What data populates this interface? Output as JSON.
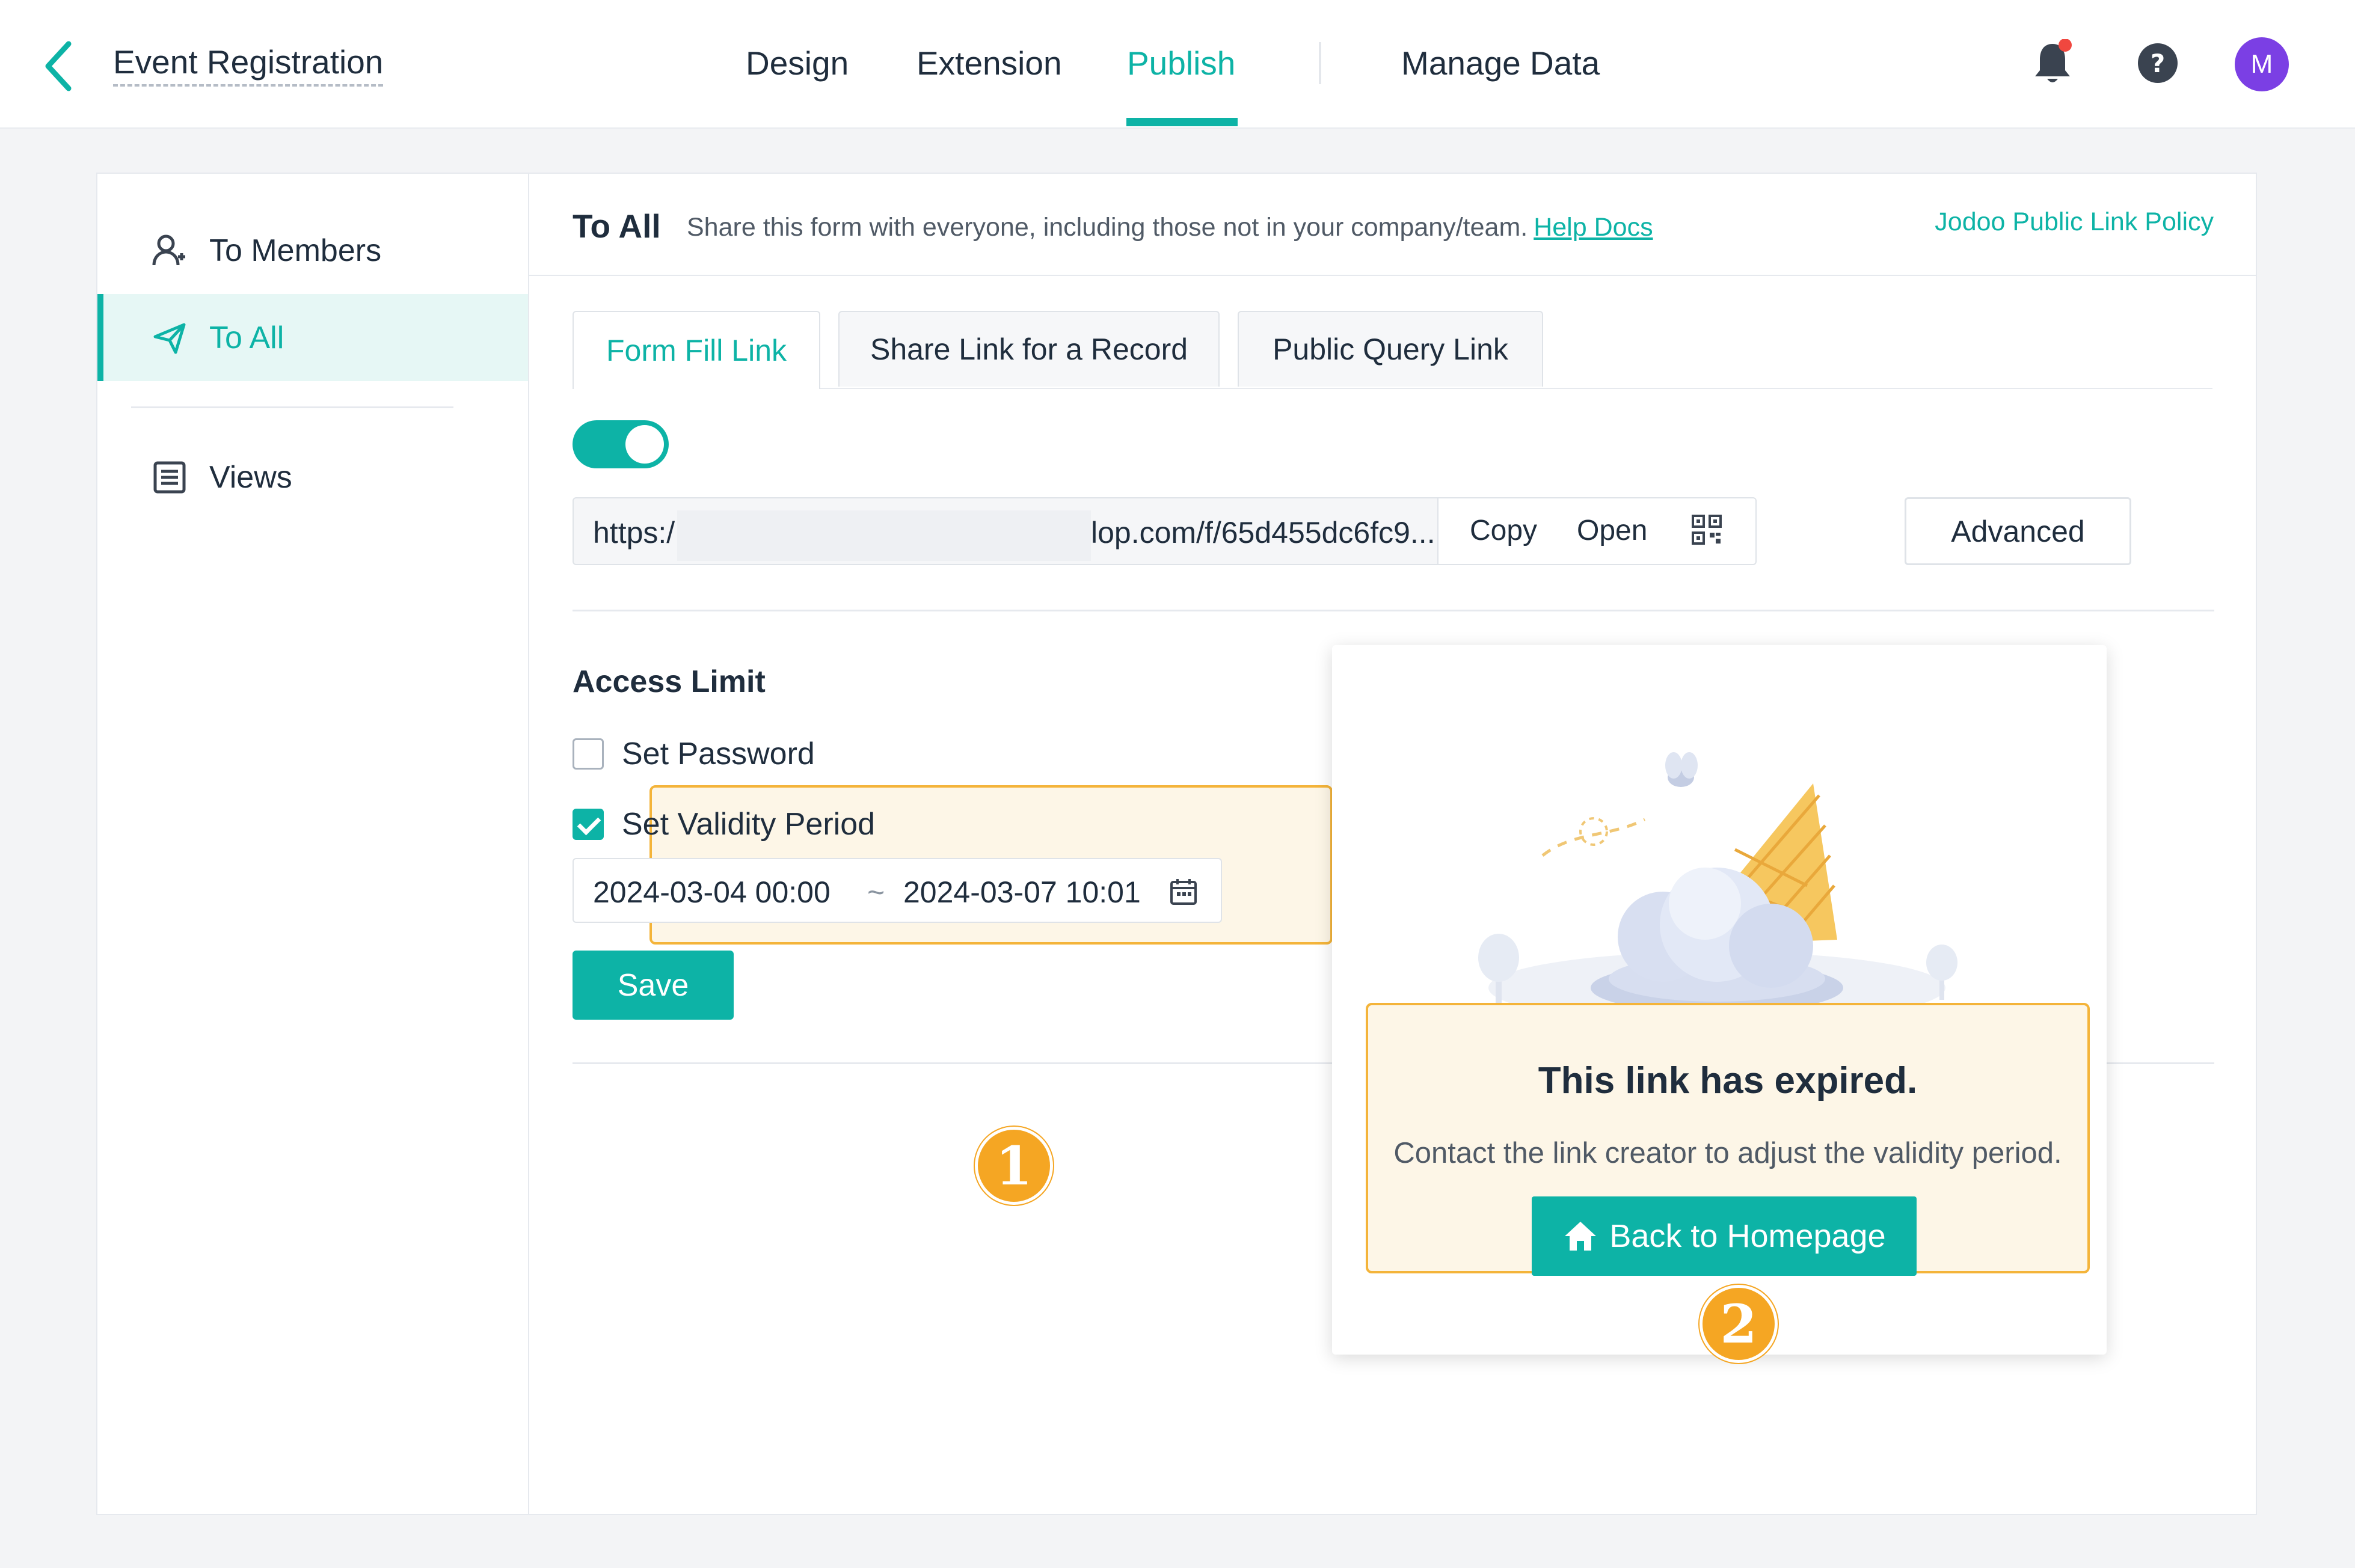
{
  "header": {
    "title": "Event Registration",
    "nav": [
      {
        "label": "Design"
      },
      {
        "label": "Extension"
      },
      {
        "label": "Publish",
        "active": true
      },
      {
        "label": "Manage Data"
      }
    ],
    "avatar_initial": "M",
    "notification_dot": true
  },
  "sidebar": {
    "items": [
      {
        "label": "To Members",
        "icon": "members-icon"
      },
      {
        "label": "To All",
        "icon": "send-icon",
        "active": true
      },
      {
        "label": "Views",
        "icon": "list-icon"
      }
    ]
  },
  "main": {
    "title": "To All",
    "description": "Share this form with everyone, including those not in your company/team.",
    "help_link": "Help Docs",
    "policy_link": "Jodoo Public Link Policy",
    "tabs": [
      {
        "label": "Form Fill Link",
        "active": true
      },
      {
        "label": "Share Link for a Record"
      },
      {
        "label": "Public Query Link"
      }
    ],
    "link_enabled": true,
    "link": {
      "prefix": "https:/",
      "suffix": "lop.com/f/65d455dc6fc9...",
      "copy_label": "Copy",
      "open_label": "Open",
      "advanced_label": "Advanced"
    },
    "access_limit": {
      "title": "Access Limit",
      "set_password_label": "Set Password",
      "set_password_checked": false,
      "set_validity_label": "Set Validity Period",
      "set_validity_checked": true,
      "start": "2024-03-04 00:00",
      "separator": "~",
      "end": "2024-03-07 10:01",
      "save_label": "Save"
    }
  },
  "annotations": {
    "badge1": "1",
    "badge2": "2"
  },
  "popup": {
    "title": "This link has expired.",
    "description": "Contact the link creator to adjust the validity period.",
    "button_label": "Back to Homepage"
  },
  "colors": {
    "accent": "#0db3a6",
    "highlight_border": "#f4b43a",
    "highlight_bg": "#fdf6e7",
    "badge": "#f5a623",
    "avatar": "#7b3fe4",
    "notification": "#f0473f"
  }
}
